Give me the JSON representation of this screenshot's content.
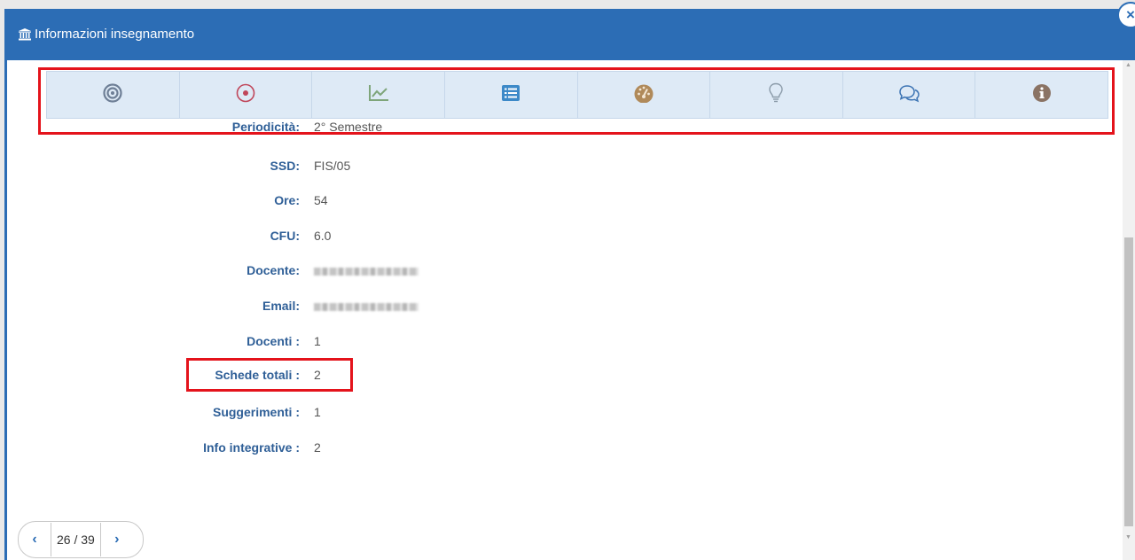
{
  "header": {
    "title": "Informazioni insegnamento",
    "icon": "bank-icon"
  },
  "close": {
    "label": "×"
  },
  "tabs": [
    {
      "icon": "target-icon",
      "color": "#6e7f96"
    },
    {
      "icon": "dot-circle-icon",
      "color": "#c0465a"
    },
    {
      "icon": "line-chart-icon",
      "color": "#7ea57a"
    },
    {
      "icon": "list-icon",
      "color": "#3c89c8"
    },
    {
      "icon": "dashboard-icon",
      "color": "#b08a5a"
    },
    {
      "icon": "lightbulb-icon",
      "color": "#8a9aa8"
    },
    {
      "icon": "comments-icon",
      "color": "#3c74b4"
    },
    {
      "icon": "info-circle-icon",
      "color": "#8a7364"
    }
  ],
  "info": {
    "periodicita": {
      "label": "Periodicità:",
      "value": "2° Semestre"
    },
    "ssd": {
      "label": "SSD:",
      "value": "FIS/05"
    },
    "ore": {
      "label": "Ore:",
      "value": "54"
    },
    "cfu": {
      "label": "CFU:",
      "value": "6.0"
    },
    "docente": {
      "label": "Docente:",
      "value": ""
    },
    "email": {
      "label": "Email:",
      "value": ""
    },
    "docenti": {
      "label": "Docenti :",
      "value": "1"
    },
    "schede": {
      "label": "Schede totali :",
      "value": "2"
    },
    "suggerimenti": {
      "label": "Suggerimenti :",
      "value": "1"
    },
    "info_integrative": {
      "label": "Info integrative :",
      "value": "2"
    }
  },
  "pager": {
    "prev": "‹",
    "count": "26 / 39",
    "next": "›"
  },
  "colors": {
    "header_bg": "#2c6db5",
    "label": "#2f5f97",
    "highlight": "#e4131b"
  }
}
